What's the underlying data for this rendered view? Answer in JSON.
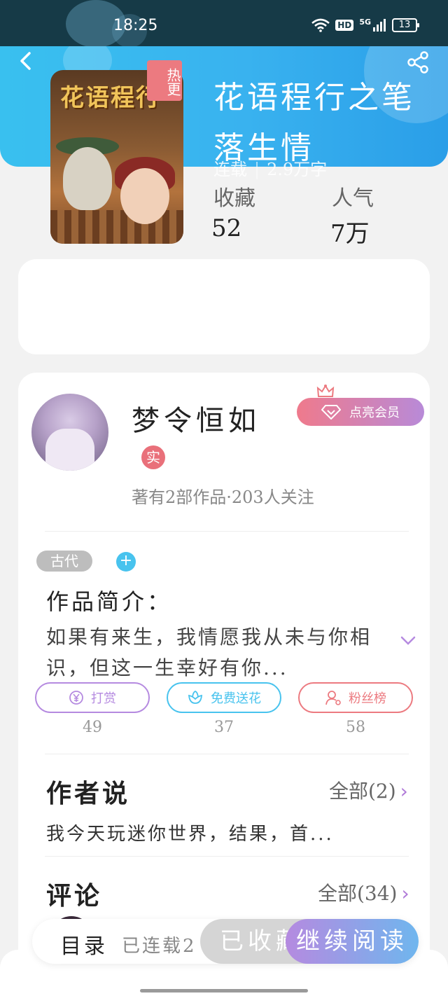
{
  "status_bar": {
    "time": "18:25",
    "network": "5G",
    "hd": "HD",
    "battery": "13"
  },
  "book": {
    "title": "花语程行之笔落生情",
    "hot_badge": "热更",
    "status": "连载",
    "word_count": "2.9万字",
    "cover_art_text": "花语程行"
  },
  "stats": {
    "collect_label": "收藏",
    "collect_value": "52",
    "popularity_label": "人气",
    "popularity_value": "7万"
  },
  "author": {
    "name": "梦令恒如",
    "verified_badge": "实",
    "summary": "著有2部作品·203人关注",
    "member_button": "点亮会员"
  },
  "tags": {
    "items": [
      "古代"
    ],
    "add": "+"
  },
  "intro": {
    "label": "作品简介：",
    "text": "如果有来生，我情愿我从未与你相识，但这一生幸好有你..."
  },
  "actions": [
    {
      "label": "打赏",
      "count": "49",
      "icon": "yen-coin-icon",
      "color": "#b58ae0"
    },
    {
      "label": "免费送花",
      "count": "37",
      "icon": "flower-icon",
      "color": "#48c3ee"
    },
    {
      "label": "粉丝榜",
      "count": "58",
      "icon": "user-icon",
      "color": "#ec7a80"
    }
  ],
  "author_says": {
    "title": "作者说",
    "more": "全部(2)",
    "text": "我今天玩迷你世界，结果，首..."
  },
  "comments": {
    "title": "评论",
    "more": "全部(34)"
  },
  "bottom_bar": {
    "toc": "目录",
    "serial": "已连载2",
    "collected": "已收藏",
    "continue": "继续阅读"
  },
  "colors": {
    "header_blue": "#39b2ef",
    "accent_purple": "#b58ae0",
    "accent_pink": "#ec7a80",
    "accent_cyan": "#48c3ee"
  }
}
